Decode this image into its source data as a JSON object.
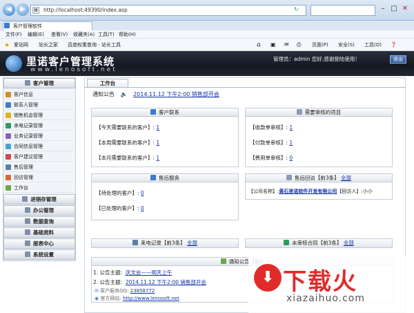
{
  "browser": {
    "address": "http://localhost:49390/index.asp",
    "tab_title": "客户管理软件",
    "menu": [
      "文件(F)",
      "编辑(E)",
      "查看(V)",
      "收藏夹(A)",
      "工具(T)",
      "帮助(H)"
    ],
    "favorites": [
      "爱站网",
      "站长之家",
      "百度权重查询 - 站长工具"
    ],
    "tools": [
      "页面(P)",
      "安全(S)",
      "工具(O)"
    ]
  },
  "app": {
    "title": "里诺客户管理系统",
    "url": "www.lenosoft.net",
    "welcome": "管理员：admin 您好,感谢登陆使用！",
    "logout": "退出"
  },
  "sidebar": {
    "section_customer": "客户管理",
    "items": [
      "客户信息",
      "联系人管理",
      "销售机会管理",
      "来电记录管理",
      "业务记录管理",
      "合同信息管理",
      "客户建议管理",
      "售后管理",
      "回访管理",
      "工作台"
    ],
    "sections": [
      "进销存管理",
      "办公管理",
      "数据查询",
      "基础资料",
      "报表中心",
      "系统设置"
    ]
  },
  "main": {
    "tab": "工作台",
    "notice_label": "通知公告",
    "notice_text": "2014.11.12 下午2:00 销售部开会",
    "contact": {
      "title": "客户联系",
      "rows": [
        {
          "label": "【今天需要联系的客户】:",
          "value": "1"
        },
        {
          "label": "【本周需要联系的客户】:",
          "value": "1"
        },
        {
          "label": "【本月需要联系的客户】:",
          "value": "1"
        }
      ]
    },
    "review": {
      "title": "需要审核的项目",
      "rows": [
        {
          "label": "【收款单审核】:",
          "value": "1"
        },
        {
          "label": "【付款单审核】:",
          "value": "1"
        },
        {
          "label": "【费用单审核】:",
          "value": "0"
        }
      ]
    },
    "aftersale": {
      "title": "售后服务",
      "rows": [
        {
          "label": "【待处理的客户】:",
          "value": "0"
        },
        {
          "label": "【已处理的客户】:",
          "value": "0"
        }
      ]
    },
    "revisit": {
      "title": "售后回访【前3条】",
      "all": "全部",
      "row_label": "【公司名称】:",
      "company": "黄石里诺软件开发有限公司",
      "visitor_label": "【回访人】:",
      "visitor": "小小"
    },
    "calls": {
      "title": "来电记录【前3条】",
      "all": "全部"
    },
    "contracts": {
      "title": "未审核合同【前3条】",
      "all": "全部"
    },
    "announce": {
      "title": "通知公告【前5",
      "items": [
        {
          "label": "1. 公告主题:",
          "text": "庆文会——明天上午"
        },
        {
          "label": "2. 公告主题:",
          "text": "2014.11.12 下午2:00 销售部开会"
        }
      ],
      "qq_label": "客户服务QQ:",
      "qq": "23858772",
      "site_label": "官方网站:",
      "site": "http://www.lenosoft.net"
    }
  },
  "watermark": {
    "text": "下载火",
    "sub": "xiazaihuo.com"
  }
}
